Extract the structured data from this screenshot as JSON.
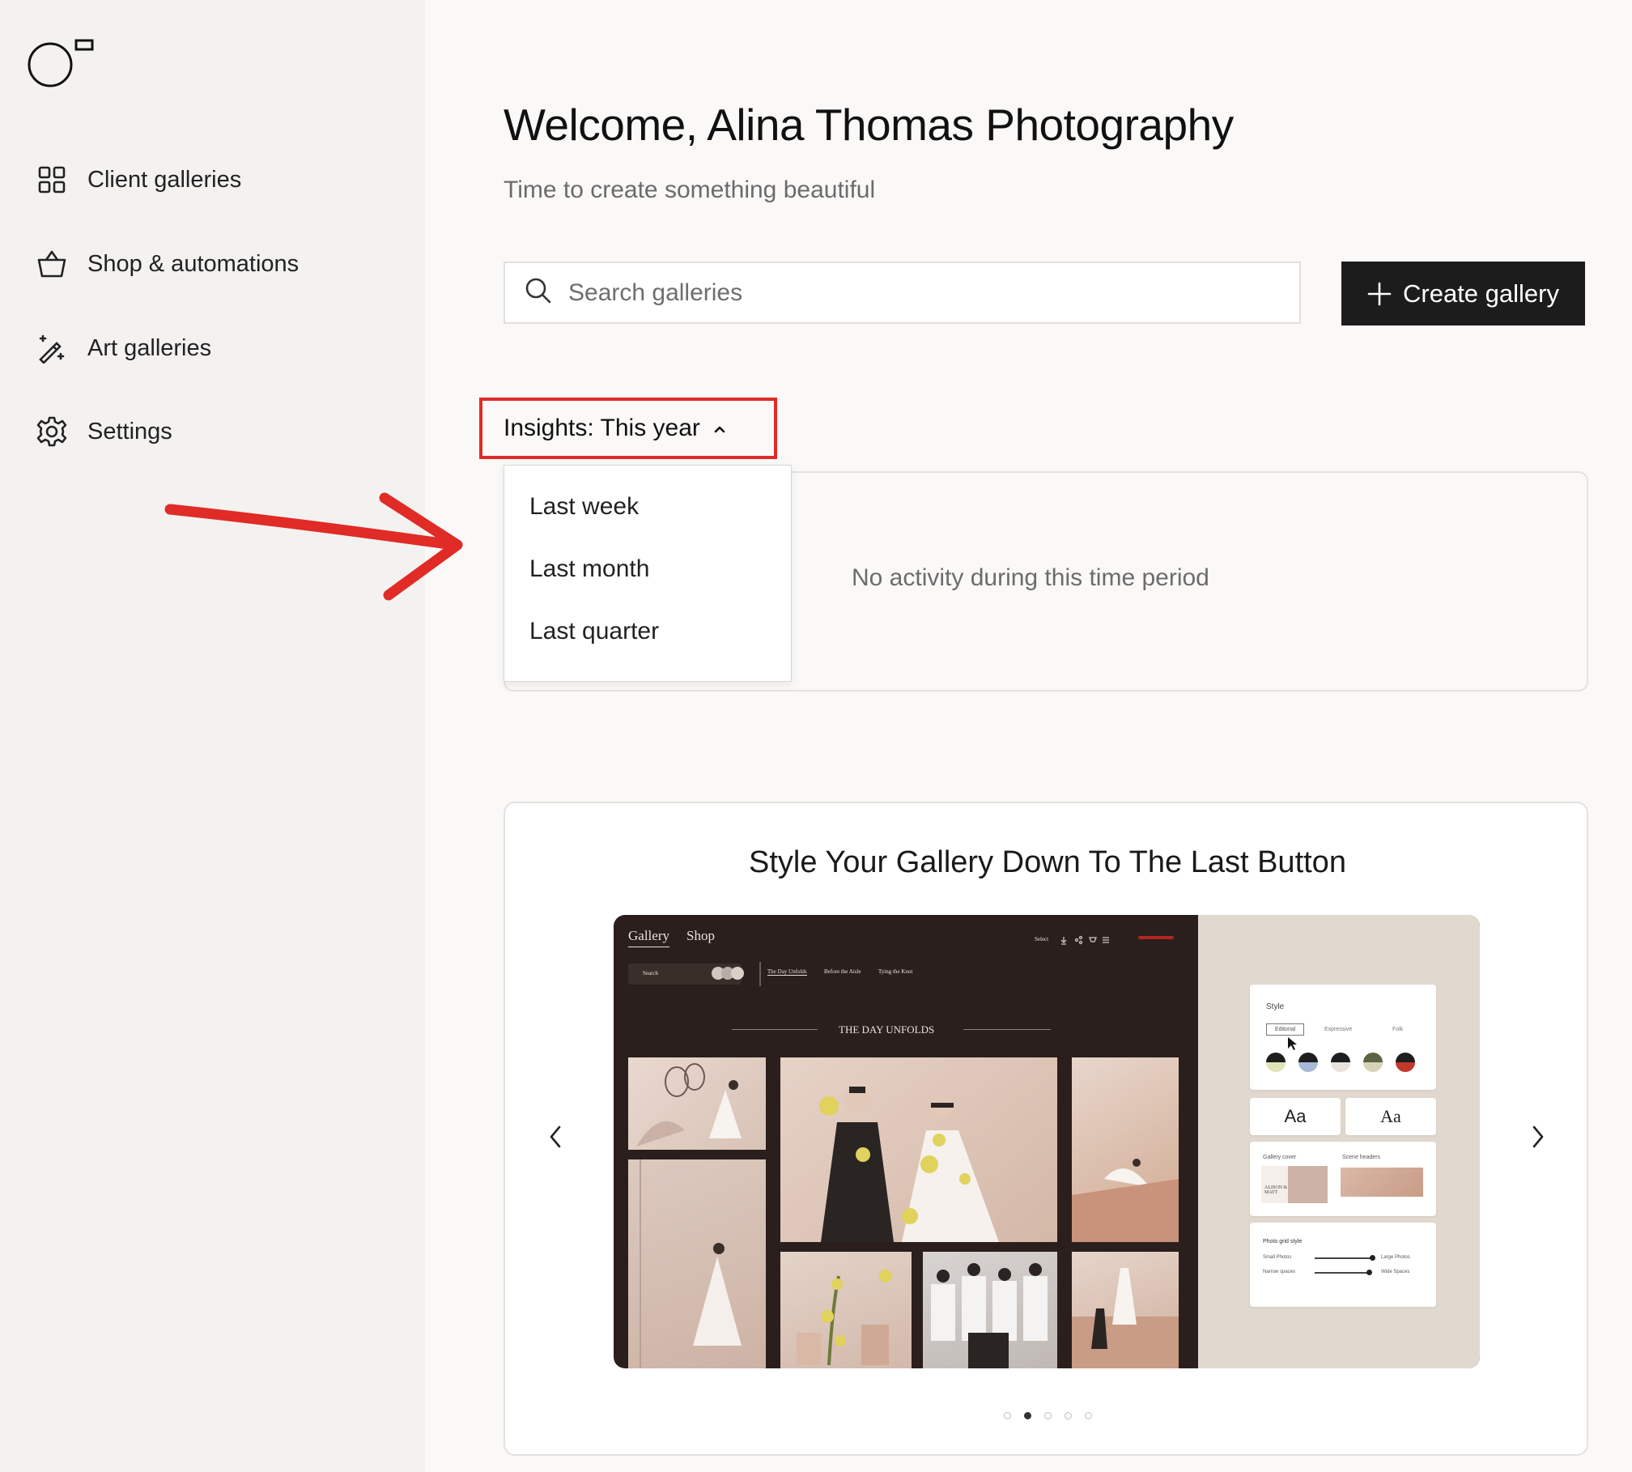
{
  "sidebar": {
    "items": [
      {
        "label": "Client galleries",
        "icon": "grid-icon"
      },
      {
        "label": "Shop & automations",
        "icon": "basket-icon"
      },
      {
        "label": "Art galleries",
        "icon": "magic-wand-icon"
      },
      {
        "label": "Settings",
        "icon": "gear-icon"
      }
    ]
  },
  "header": {
    "title": "Welcome, Alina Thomas Photography",
    "subtitle": "Time to create something beautiful"
  },
  "search": {
    "placeholder": "Search galleries"
  },
  "create_button": {
    "label": "Create gallery"
  },
  "insights": {
    "selector_label": "Insights: This year",
    "options": [
      "Last week",
      "Last month",
      "Last quarter"
    ],
    "empty_message": "No activity during this time period"
  },
  "promo": {
    "title": "Style Your Gallery Down To The Last Button",
    "preview": {
      "nav": [
        "Gallery",
        "Shop"
      ],
      "toolbar_select": "Select",
      "search": "Search",
      "scene_tabs": [
        "The Day Unfolds",
        "Before the Aisle",
        "Tying the Knot"
      ],
      "scene_title": "THE DAY UNFOLDS",
      "style_heading": "Style",
      "style_options": [
        "Editorial",
        "Expressive",
        "Folk"
      ],
      "font_samples": [
        "Aa",
        "Aa"
      ],
      "gallery_cover": "Gallery cover",
      "cover_text": "ALISON & MATT",
      "scene_headers": "Scene headers",
      "photo_grid_style": "Photo grid style",
      "slider_rows": [
        {
          "left": "Small Photos",
          "right": "Large Photos"
        },
        {
          "left": "Narrow spaces",
          "right": "Wide Spaces"
        }
      ]
    },
    "slides_total": 5,
    "active_slide": 2
  },
  "colors": {
    "accent_annotation": "#e02b26",
    "primary_button": "#1c1c1c",
    "sidebar_bg": "#f3f2f0"
  }
}
